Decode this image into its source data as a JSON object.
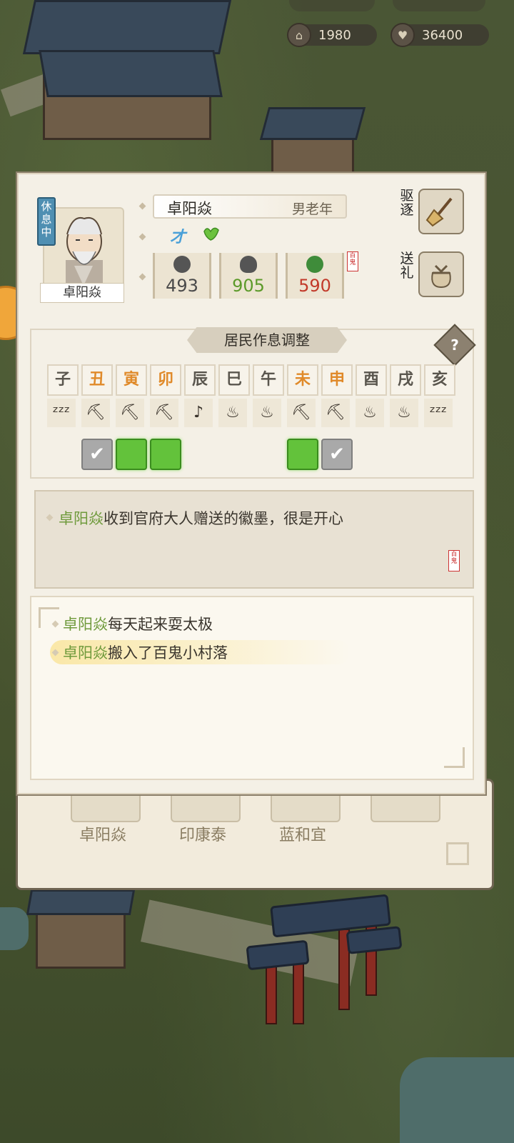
{
  "top_counters": [
    {
      "icon": "temple-icon",
      "value": "1980"
    },
    {
      "icon": "heart-icon",
      "value": "36400"
    }
  ],
  "dialog": {
    "status_tag": "休息中",
    "resident": {
      "name": "卓阳焱",
      "gender_age": "男老年",
      "traits": [
        "才",
        "heart-leaf-icon"
      ],
      "stats": [
        {
          "icon": "flower-icon",
          "value": "493",
          "color": "#4a4a4a"
        },
        {
          "icon": "heart-icon",
          "value": "905",
          "color": "#5c9a2a"
        },
        {
          "icon": "leaf-icon",
          "value": "590",
          "color": "#c23a2a"
        }
      ],
      "seal": "百鬼"
    },
    "actions": [
      {
        "label": "驱逐",
        "icon": "broom-icon"
      },
      {
        "label": "送礼",
        "icon": "gift-bag-icon"
      }
    ],
    "schedule": {
      "title": "居民作息调整",
      "help": "?",
      "hours": [
        {
          "label": "子",
          "kind": "night",
          "activity": "sleep-icon",
          "check": "none"
        },
        {
          "label": "丑",
          "kind": "day",
          "activity": "pickaxe-icon",
          "check": "gray"
        },
        {
          "label": "寅",
          "kind": "day",
          "activity": "pickaxe-icon",
          "check": "green"
        },
        {
          "label": "卯",
          "kind": "day",
          "activity": "pickaxe-icon",
          "check": "green"
        },
        {
          "label": "辰",
          "kind": "night",
          "activity": "leisure-icon",
          "check": "none"
        },
        {
          "label": "巳",
          "kind": "night",
          "activity": "bowl-icon",
          "check": "none"
        },
        {
          "label": "午",
          "kind": "night",
          "activity": "bowl-icon",
          "check": "none"
        },
        {
          "label": "未",
          "kind": "day",
          "activity": "pickaxe-icon",
          "check": "green"
        },
        {
          "label": "申",
          "kind": "day",
          "activity": "pickaxe-icon",
          "check": "gray"
        },
        {
          "label": "酉",
          "kind": "night",
          "activity": "bowl-icon",
          "check": "none"
        },
        {
          "label": "戌",
          "kind": "night",
          "activity": "bowl-icon",
          "check": "none"
        },
        {
          "label": "亥",
          "kind": "night",
          "activity": "sleep-icon",
          "check": "none"
        }
      ]
    },
    "message": {
      "name": "卓阳焱",
      "text": "收到官府大人赠送的徽墨，很是开心",
      "seal": "百鬼"
    },
    "log": [
      {
        "name": "卓阳焱",
        "text": "每天起来耍太极"
      },
      {
        "name": "卓阳焱",
        "text": "搬入了百鬼小村落"
      }
    ]
  },
  "back_panel": {
    "residents": [
      "卓阳焱",
      "印康泰",
      "蓝和宜"
    ]
  }
}
